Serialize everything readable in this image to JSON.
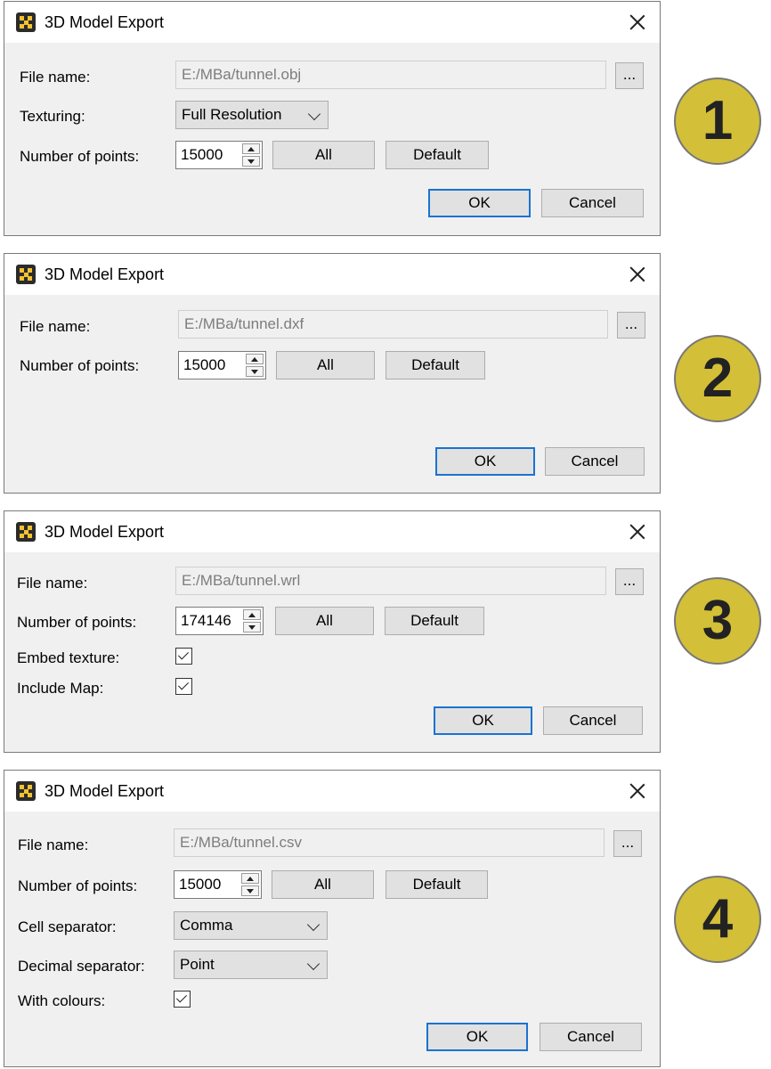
{
  "dialogs": [
    {
      "title": "3D Model Export",
      "file_name_label": "File name:",
      "file_name_value": "E:/MBa/tunnel.obj",
      "browse_label": "...",
      "texturing_label": "Texturing:",
      "texturing_value": "Full Resolution",
      "points_label": "Number of points:",
      "points_value": "15000",
      "all_label": "All",
      "default_label": "Default",
      "ok_label": "OK",
      "cancel_label": "Cancel",
      "badge": "1"
    },
    {
      "title": "3D Model Export",
      "file_name_label": "File name:",
      "file_name_value": "E:/MBa/tunnel.dxf",
      "browse_label": "...",
      "points_label": "Number of points:",
      "points_value": "15000",
      "all_label": "All",
      "default_label": "Default",
      "ok_label": "OK",
      "cancel_label": "Cancel",
      "badge": "2"
    },
    {
      "title": "3D Model Export",
      "file_name_label": "File name:",
      "file_name_value": "E:/MBa/tunnel.wrl",
      "browse_label": "...",
      "points_label": "Number of points:",
      "points_value": "174146",
      "all_label": "All",
      "default_label": "Default",
      "embed_texture_label": "Embed texture:",
      "embed_texture_checked": true,
      "include_map_label": "Include Map:",
      "include_map_checked": true,
      "ok_label": "OK",
      "cancel_label": "Cancel",
      "badge": "3"
    },
    {
      "title": "3D Model Export",
      "file_name_label": "File name:",
      "file_name_value": "E:/MBa/tunnel.csv",
      "browse_label": "...",
      "points_label": "Number of points:",
      "points_value": "15000",
      "all_label": "All",
      "default_label": "Default",
      "cell_sep_label": "Cell separator:",
      "cell_sep_value": "Comma",
      "decimal_sep_label": "Decimal separator:",
      "decimal_sep_value": "Point",
      "with_colours_label": "With colours:",
      "with_colours_checked": true,
      "ok_label": "OK",
      "cancel_label": "Cancel",
      "badge": "4"
    }
  ],
  "colors": {
    "badge_fill": "#d3bf38",
    "primary_border": "#1a73d1",
    "icon_accent": "#f2c230"
  }
}
